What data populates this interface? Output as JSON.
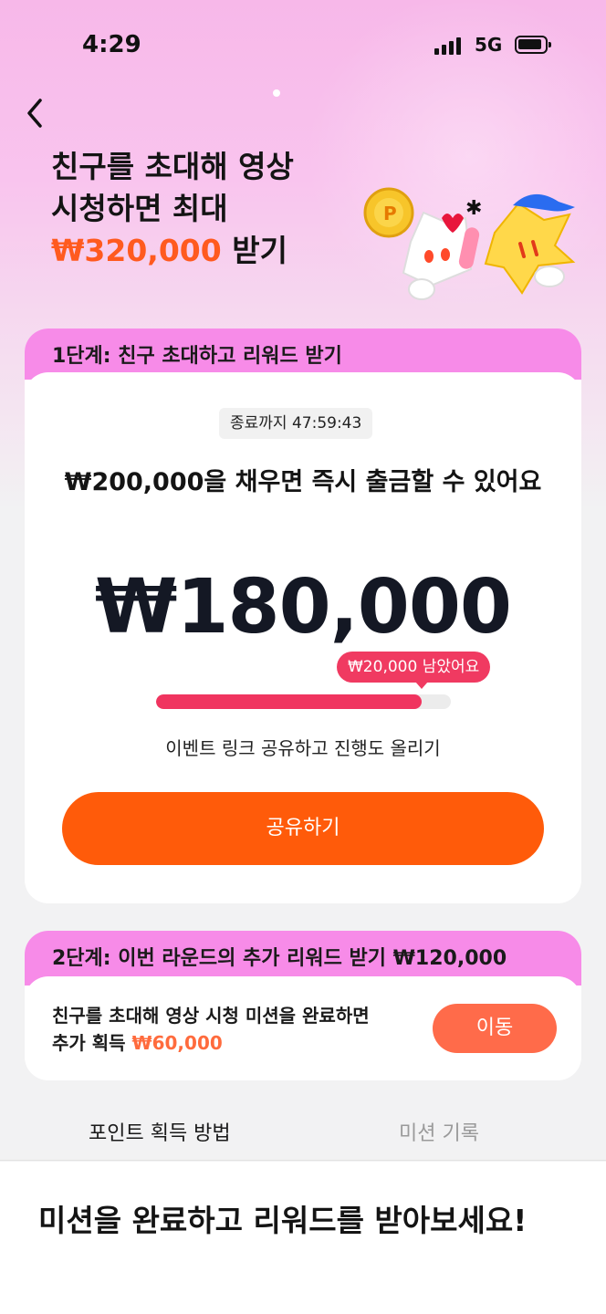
{
  "status_bar": {
    "time": "4:29",
    "network": "5G"
  },
  "hero": {
    "title_line1": "친구를 초대해 영상",
    "title_line2": "시청하면 최대",
    "title_amount": "₩320,000",
    "title_suffix": " 받기"
  },
  "stage1": {
    "header": "1단계: 친구 초대하고 리워드 받기",
    "timer": "종료까지 47:59:43",
    "goal": "₩200,000을 채우면 즉시 출금할 수 있어요",
    "current_amount": "₩180,000",
    "remaining_amount": "₩20,000",
    "remaining_suffix": " 남았어요",
    "progress": 0.9,
    "hint": "이벤트 링크 공유하고 진행도 올리기",
    "share_label": "공유하기"
  },
  "stage2": {
    "header": "2단계: 이번 라운드의 추가 리워드 받기 ₩120,000",
    "mission_line1": "친구를 초대해 영상 시청 미션을 완료하면",
    "mission_prefix": "추가 획득 ",
    "mission_amount": "₩60,000",
    "move_label": "이동"
  },
  "tabs": {
    "active": "포인트 획득 방법",
    "inactive": "미션 기록"
  },
  "bottom": {
    "title": "미션을 완료하고 리워드를 받아보세요!"
  },
  "colors": {
    "accent": "#ff5b0a",
    "progress": "#f0345f",
    "header_pink": "#f78be8"
  }
}
